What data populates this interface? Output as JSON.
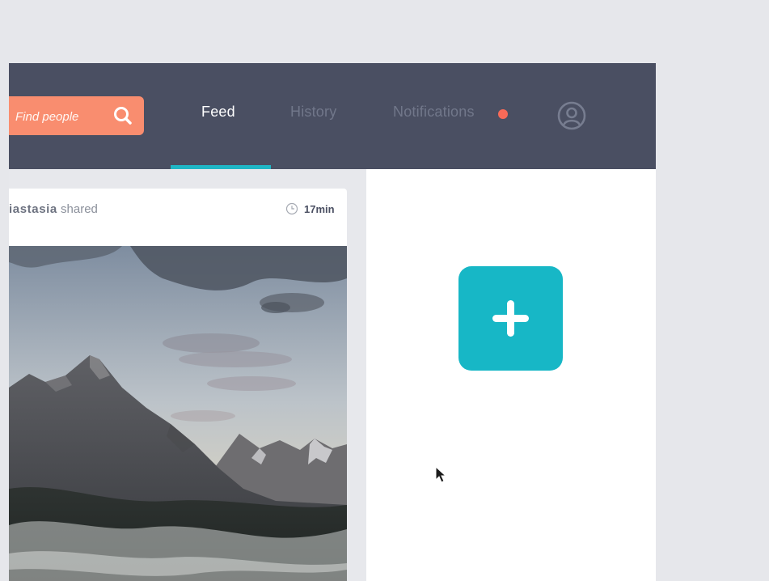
{
  "search": {
    "placeholder": "Find people",
    "icon": "search-icon"
  },
  "nav": {
    "tabs": [
      {
        "label": "Feed",
        "active": true
      },
      {
        "label": "History",
        "active": false
      },
      {
        "label": "Notifications",
        "active": false,
        "has_unread": true
      }
    ],
    "profile_icon": "user-circle-icon"
  },
  "post": {
    "author": "iastasia",
    "action": "shared",
    "time": "17min",
    "image": "mountain-landscape"
  },
  "add_button": {
    "icon": "plus-icon"
  },
  "colors": {
    "navbar": "#4a4f62",
    "search": "#f98d6f",
    "accent": "#1fb6c5",
    "notification_dot": "#f76a58"
  }
}
